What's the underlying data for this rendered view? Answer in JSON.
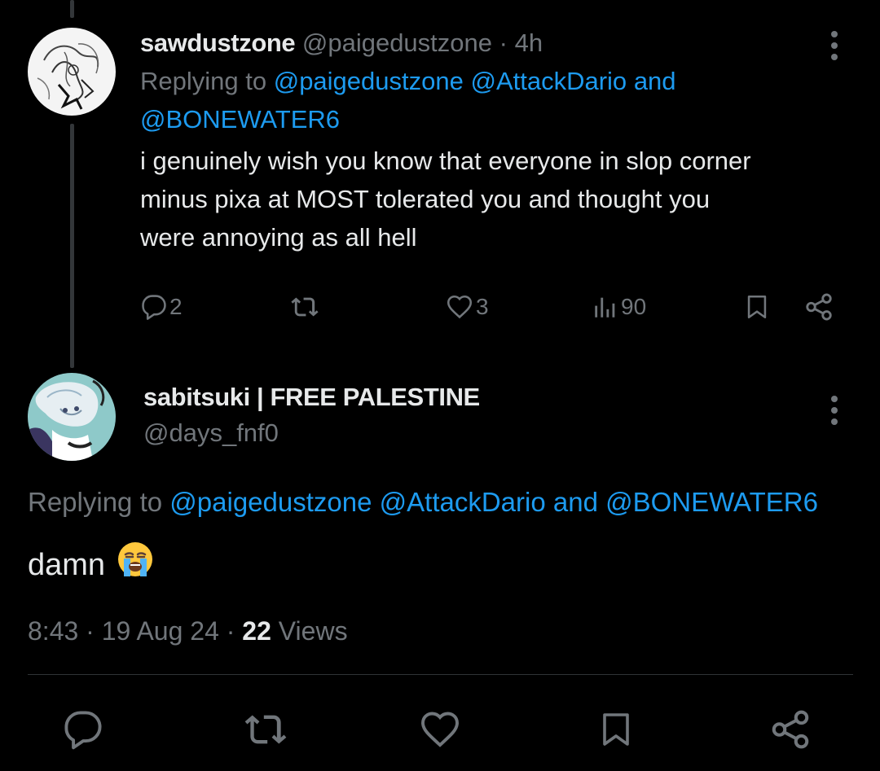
{
  "reply_tweet": {
    "display_name": "sawdustzone",
    "handle": "@paigedustzone",
    "separator": "·",
    "time": "4h",
    "replying_prefix": "Replying to",
    "replying_mention_1": "@paigedustzone",
    "replying_mention_2": "@AttackDario",
    "replying_and": "and",
    "replying_mention_3": "@BONEWATER6",
    "text_line_1": "i genuinely wish you know that everyone in slop corner",
    "text_line_2": "minus pixa at MOST tolerated you and thought you",
    "text_line_3": "were annoying as all hell",
    "reply_count": "2",
    "like_count": "3",
    "view_count": "90"
  },
  "main_tweet": {
    "display_name": "sabitsuki | FREE PALESTINE",
    "handle": "@days_fnf0",
    "replying_prefix": "Replying to",
    "replying_mention_1": "@paigedustzone",
    "replying_mention_2": "@AttackDario",
    "replying_and": "and",
    "replying_mention_3": "@BONEWATER6",
    "text": "damn",
    "emoji": "loudly-crying-face",
    "time": "8:43",
    "dot": "·",
    "date": "19 Aug 24",
    "views_count": "22",
    "views_label": "Views"
  },
  "colors": {
    "background": "#000000",
    "text": "#e7e9ea",
    "muted": "#71767b",
    "link": "#1d9bf0",
    "divider": "#2f3336"
  }
}
